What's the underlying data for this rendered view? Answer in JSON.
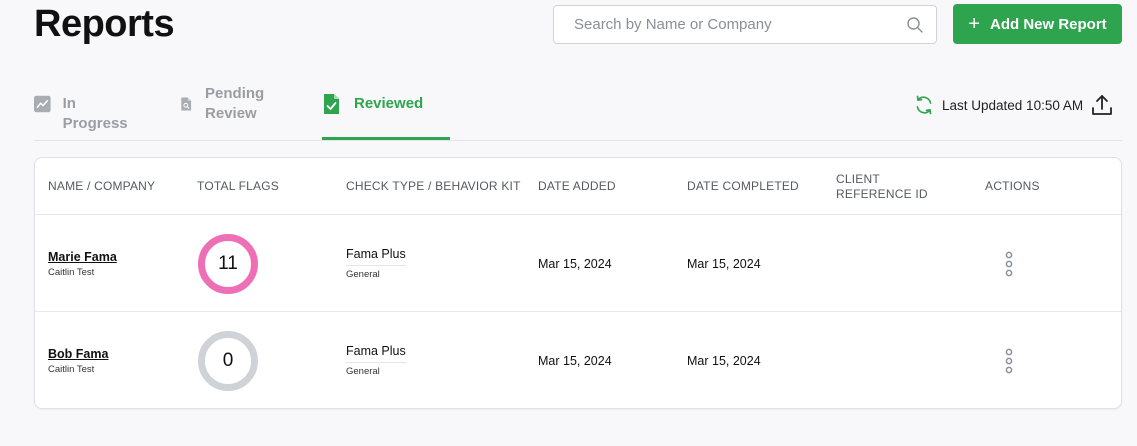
{
  "page": {
    "title": "Reports"
  },
  "search": {
    "placeholder": "Search by Name or Company",
    "value": ""
  },
  "add_button": {
    "label": "Add New Report"
  },
  "tabs": [
    {
      "label": "In Progress",
      "active": false
    },
    {
      "label": "Pending Review",
      "active": false
    },
    {
      "label": "Reviewed",
      "active": true
    }
  ],
  "status": {
    "last_updated": "Last Updated 10:50 AM"
  },
  "colors": {
    "accent": "#2ea44f",
    "flag_ring_active": "#ee6fb5",
    "flag_ring_zero": "#cfd3d7"
  },
  "table": {
    "columns": [
      "NAME / COMPANY",
      "TOTAL FLAGS",
      "CHECK TYPE / BEHAVIOR KIT",
      "DATE ADDED",
      "DATE COMPLETED",
      "CLIENT REFERENCE ID",
      "ACTIONS"
    ],
    "rows": [
      {
        "name": "Marie Fama",
        "company": "Caitlin Test",
        "total_flags": "11",
        "check_type": "Fama Plus",
        "behavior_kit": "General",
        "date_added": "Mar 15, 2024",
        "date_completed": "Mar 15, 2024",
        "client_reference_id": ""
      },
      {
        "name": "Bob Fama",
        "company": "Caitlin Test",
        "total_flags": "0",
        "check_type": "Fama Plus",
        "behavior_kit": "General",
        "date_added": "Mar 15, 2024",
        "date_completed": "Mar 15, 2024",
        "client_reference_id": ""
      }
    ]
  }
}
